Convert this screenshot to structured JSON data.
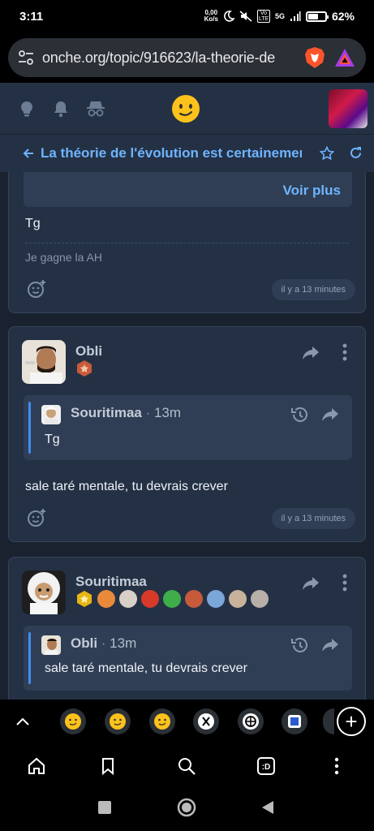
{
  "status": {
    "time": "3:11",
    "net_speed_top": "0,00",
    "net_speed_bottom": "Ko/s",
    "volte": "Vo LTE",
    "signal": "5G",
    "battery_pct": "62%",
    "battery_level": 0.62
  },
  "browser": {
    "url": "onche.org/topic/916623/la-theorie-de"
  },
  "header": {
    "logo": "slightly-smiling-face-emoji"
  },
  "topic": {
    "title": "La théorie de l'évolution est certainement"
  },
  "post_top": {
    "voir_plus": "Voir plus",
    "text": "Tg",
    "signature": "Je gagne la AH",
    "time": "il y a 13 minutes"
  },
  "post_obli": {
    "author": "Obli",
    "quote_author": "Souritimaa",
    "quote_sep": " · ",
    "quote_time": "13m",
    "quote_text": "Tg",
    "text": "sale taré mentale, tu devrais crever",
    "time": "il y a 13 minutes"
  },
  "post_souri": {
    "author": "Souritimaa",
    "quote_author": "Obli",
    "quote_sep": " · ",
    "quote_time": "13m",
    "quote_text": "sale taré mentale, tu devrais crever"
  },
  "colors": {
    "accent": "#6fb4ff",
    "card": "#243145",
    "background": "#1a2230"
  }
}
